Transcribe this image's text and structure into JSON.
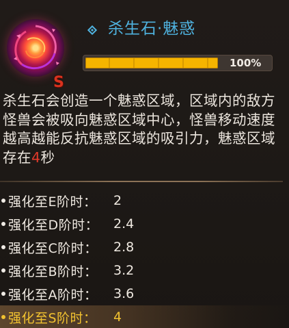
{
  "skill": {
    "icon": "charm-vortex-icon",
    "rank": "S",
    "title": "杀生石·魅惑",
    "title_marker_icon": "diamond-icon",
    "progress": 1.0,
    "progress_label": "100%"
  },
  "description": {
    "before": "杀生石会创造一个魅惑区域，区域内的敌方怪兽会被吸向魅惑区域中心，怪兽移动速度越高越能反抗魅惑区域的吸引力，魅惑区域存在",
    "highlight": "4",
    "after": "秒"
  },
  "tiers": [
    {
      "label": "强化至E阶时：",
      "value": "2",
      "active": false
    },
    {
      "label": "强化至D阶时：",
      "value": "2.4",
      "active": false
    },
    {
      "label": "强化至C阶时：",
      "value": "2.8",
      "active": false
    },
    {
      "label": "强化至B阶时：",
      "value": "3.2",
      "active": false
    },
    {
      "label": "强化至A阶时：",
      "value": "3.6",
      "active": false
    },
    {
      "label": "强化至S阶时：",
      "value": "4",
      "active": true
    }
  ],
  "colors": {
    "title": "#4fb2df",
    "bar_fill": "#f5b400",
    "highlight": "#e23a2a",
    "active_tier": "#f2c230",
    "rank": "#d8321e"
  }
}
